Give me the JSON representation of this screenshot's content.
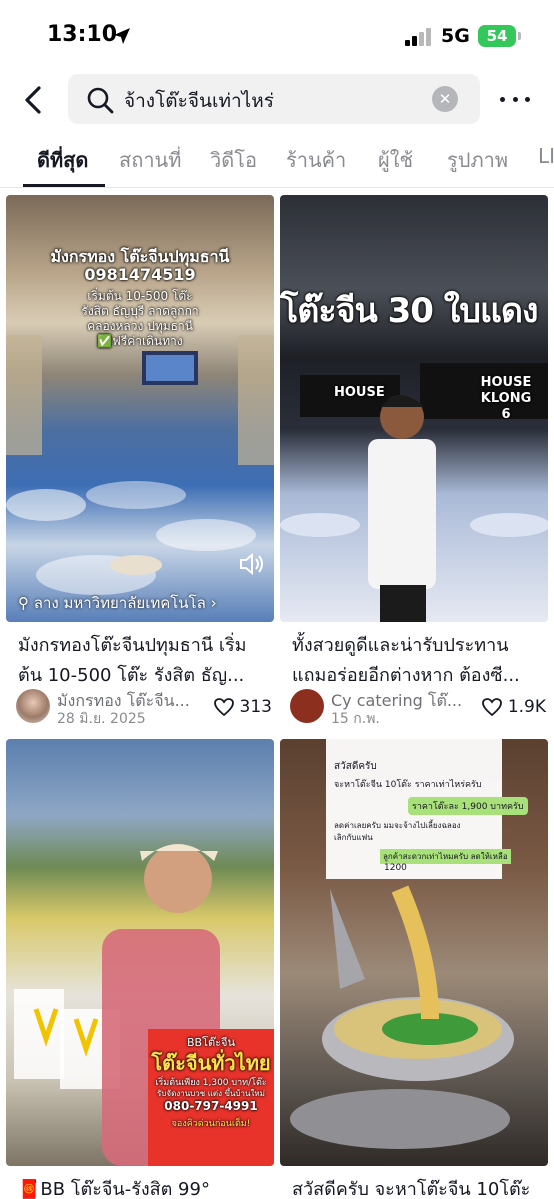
{
  "status_bar": {
    "time": "13:10",
    "network": "5G",
    "battery": "54"
  },
  "search": {
    "query": "จ้างโต๊ะจีนเท่าไหร่"
  },
  "tabs": [
    {
      "label": "ดีที่สุด",
      "active": true
    },
    {
      "label": "สถานที่"
    },
    {
      "label": "วิดีโอ"
    },
    {
      "label": "ร้านค้า"
    },
    {
      "label": "ผู้ใช้"
    },
    {
      "label": "รูปภาพ"
    },
    {
      "label": "LI"
    }
  ],
  "results": [
    {
      "overlay": [
        "มังกรทอง โต๊ะจีนปทุมธานี",
        "0981474519",
        "เริ่มต้น 10-500 โต๊ะ",
        "รังสิต ธัญบุรี ลาดลูกกา",
        "คลองหลวง ปทุมธานี",
        "✅ฟรีค่าเดินทาง"
      ],
      "location": "ลาง มหาวิทยาลัยเทคโนโล",
      "title_line1": "มังกรทองโต๊ะจีนปทุมธานี เริ่ม",
      "title_line2": "ต้น 10-500 โต๊ะ รังสิต ธัญ...",
      "author": "มังกรทอง โต๊ะจีน...",
      "date": "28 มิ.ย. 2025",
      "likes": "313"
    },
    {
      "overlay": [
        "โต๊ะจีน 30 ใบแดง",
        "HOUSE",
        "HOUSE KLONG 6"
      ],
      "title_line1": "ทั้งสวยดูดีและน่ารับประทาน",
      "title_line2": "แถมอร่อยอีกต่างหาก ต้องซี...",
      "author": "Cy catering โต๊...",
      "date": "15 ก.พ.",
      "likes": "1.9K"
    },
    {
      "overlay": [
        "BBโต๊ะจีน",
        "โต๊ะจีนทั่วไทย",
        "เริ่มต้นเพียง 1,300 บาท/โต๊ะ",
        "รับจัดงานบวช แต่ง ขึ้นบ้านใหม่",
        "080-797-4991",
        "จองคิวด่วนก่อนเต็ม!"
      ],
      "title_line1": "🧧BB โต๊ะจีน-รังสิต 99°"
    },
    {
      "overlay": [
        "สวัสดีครับ",
        "จะหาโต๊ะจีน 10โต๊ะ ราคาเท่าไหร่ครับ",
        "ราคาโต๊ะละ 1,900 บาทครับ",
        "ลดค่าเลยครับ มมจะจ้างไปเลี้ยงฉลอง",
        "เลิกกับแฟน",
        "ลูกค้าสะดวกเท่าไหมครับ ลดให้เหลือ",
        "1200"
      ],
      "title_line1": "สวัสดีครับ จะหาโต๊ะจีน 10โต๊ะ"
    }
  ],
  "colors": {
    "battery": "#34c759",
    "text": "#161823",
    "muted": "#8a8b91"
  }
}
